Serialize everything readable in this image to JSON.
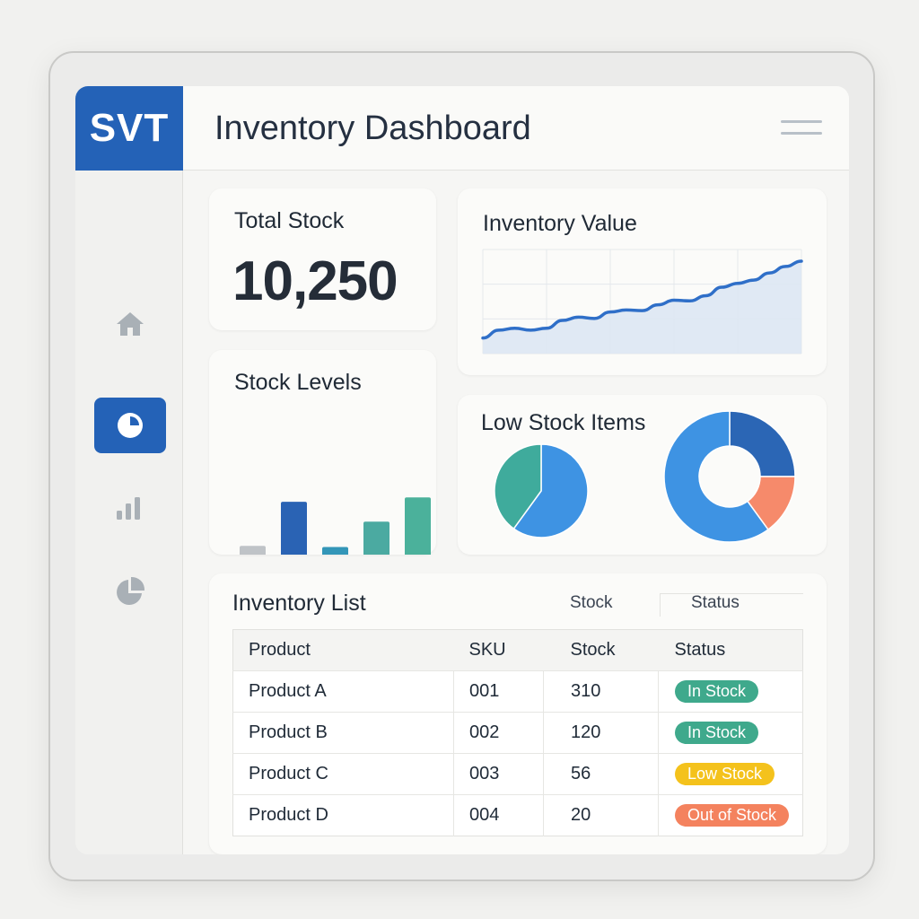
{
  "brand": {
    "logo": "SVT",
    "accent": "#2462b7"
  },
  "header": {
    "title": "Inventory Dashboard",
    "menu_icon": "hamburger-icon"
  },
  "sidebar": {
    "items": [
      {
        "icon": "home-icon",
        "active": false
      },
      {
        "icon": "pie-chart-icon",
        "active": true
      },
      {
        "icon": "bar-chart-icon",
        "active": false
      },
      {
        "icon": "pie-chart-icon",
        "active": false
      }
    ]
  },
  "total_stock": {
    "title": "Total Stock",
    "value": "10,250"
  },
  "inventory_value": {
    "title": "Inventory Value"
  },
  "stock_levels": {
    "title": "Stock Levels"
  },
  "low_stock": {
    "title": "Low Stock Items"
  },
  "inventory_list": {
    "title": "Inventory List",
    "ghost_headers": [
      "Stock",
      "Status"
    ],
    "columns": [
      "Product",
      "SKU",
      "Stock",
      "Status"
    ],
    "rows": [
      {
        "product": "Product A",
        "sku": "001",
        "stock": "310",
        "status": "In Stock",
        "status_color": "#3fa98c"
      },
      {
        "product": "Product B",
        "sku": "002",
        "stock": "120",
        "status": "In Stock",
        "status_color": "#3fa98c"
      },
      {
        "product": "Product C",
        "sku": "003",
        "stock": "56",
        "status": "Low Stock",
        "status_color": "#f4c21c"
      },
      {
        "product": "Product D",
        "sku": "004",
        "stock": "20",
        "status": "Out of Stock",
        "status_color": "#f4825e"
      }
    ]
  },
  "chart_data": [
    {
      "type": "line",
      "title": "Inventory Value",
      "x": [
        0,
        1,
        2,
        3,
        4,
        5,
        6,
        7,
        8,
        9,
        10,
        11,
        12,
        13,
        14,
        15,
        16,
        17,
        18,
        19,
        20
      ],
      "values": [
        24,
        36,
        39,
        36,
        39,
        51,
        56,
        54,
        64,
        67,
        66,
        75,
        82,
        81,
        89,
        102,
        108,
        113,
        124,
        134,
        142
      ],
      "ylim": [
        0,
        160
      ],
      "area": true,
      "grid": true,
      "color": "#2f6fc8",
      "fill": "#dde7f3"
    },
    {
      "type": "bar",
      "title": "Stock Levels",
      "values": [
        60,
        100,
        59,
        82,
        104
      ],
      "colors": [
        "#bfc3c7",
        "#2a63b4",
        "#3396b8",
        "#4baaa1",
        "#4bb19b"
      ],
      "ylim": [
        0,
        105
      ]
    },
    {
      "type": "pie",
      "title": "Low Stock Items",
      "slices": [
        {
          "value": 60,
          "color": "#3e93e3"
        },
        {
          "value": 40,
          "color": "#3fab9c"
        }
      ]
    },
    {
      "type": "pie",
      "donut": true,
      "title": "Low Stock Items",
      "slices": [
        {
          "value": 25,
          "color": "#2b66b5"
        },
        {
          "value": 15,
          "color": "#f68a6b"
        },
        {
          "value": 60,
          "color": "#3e93e3"
        }
      ]
    }
  ]
}
